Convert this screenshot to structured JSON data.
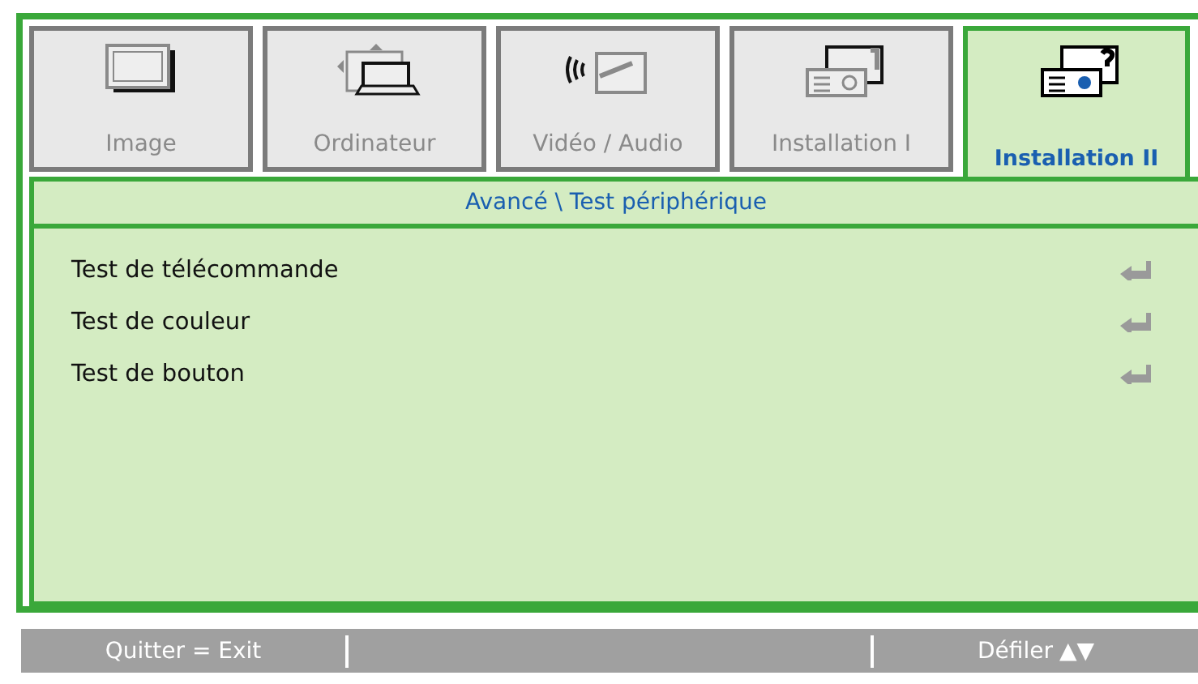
{
  "tabs": [
    {
      "label": "Image",
      "selected": false
    },
    {
      "label": "Ordinateur",
      "selected": false
    },
    {
      "label": "Vidéo / Audio",
      "selected": false
    },
    {
      "label": "Installation I",
      "selected": false
    },
    {
      "label": "Installation II",
      "selected": true
    }
  ],
  "breadcrumb": "Avancé \\ Test périphérique",
  "items": [
    {
      "label": "Test de télécommande"
    },
    {
      "label": "Test de couleur"
    },
    {
      "label": "Test de bouton"
    }
  ],
  "status_bar": {
    "exit": "Quitter = Exit",
    "scroll": "Défiler",
    "arrows": "▲▼"
  }
}
